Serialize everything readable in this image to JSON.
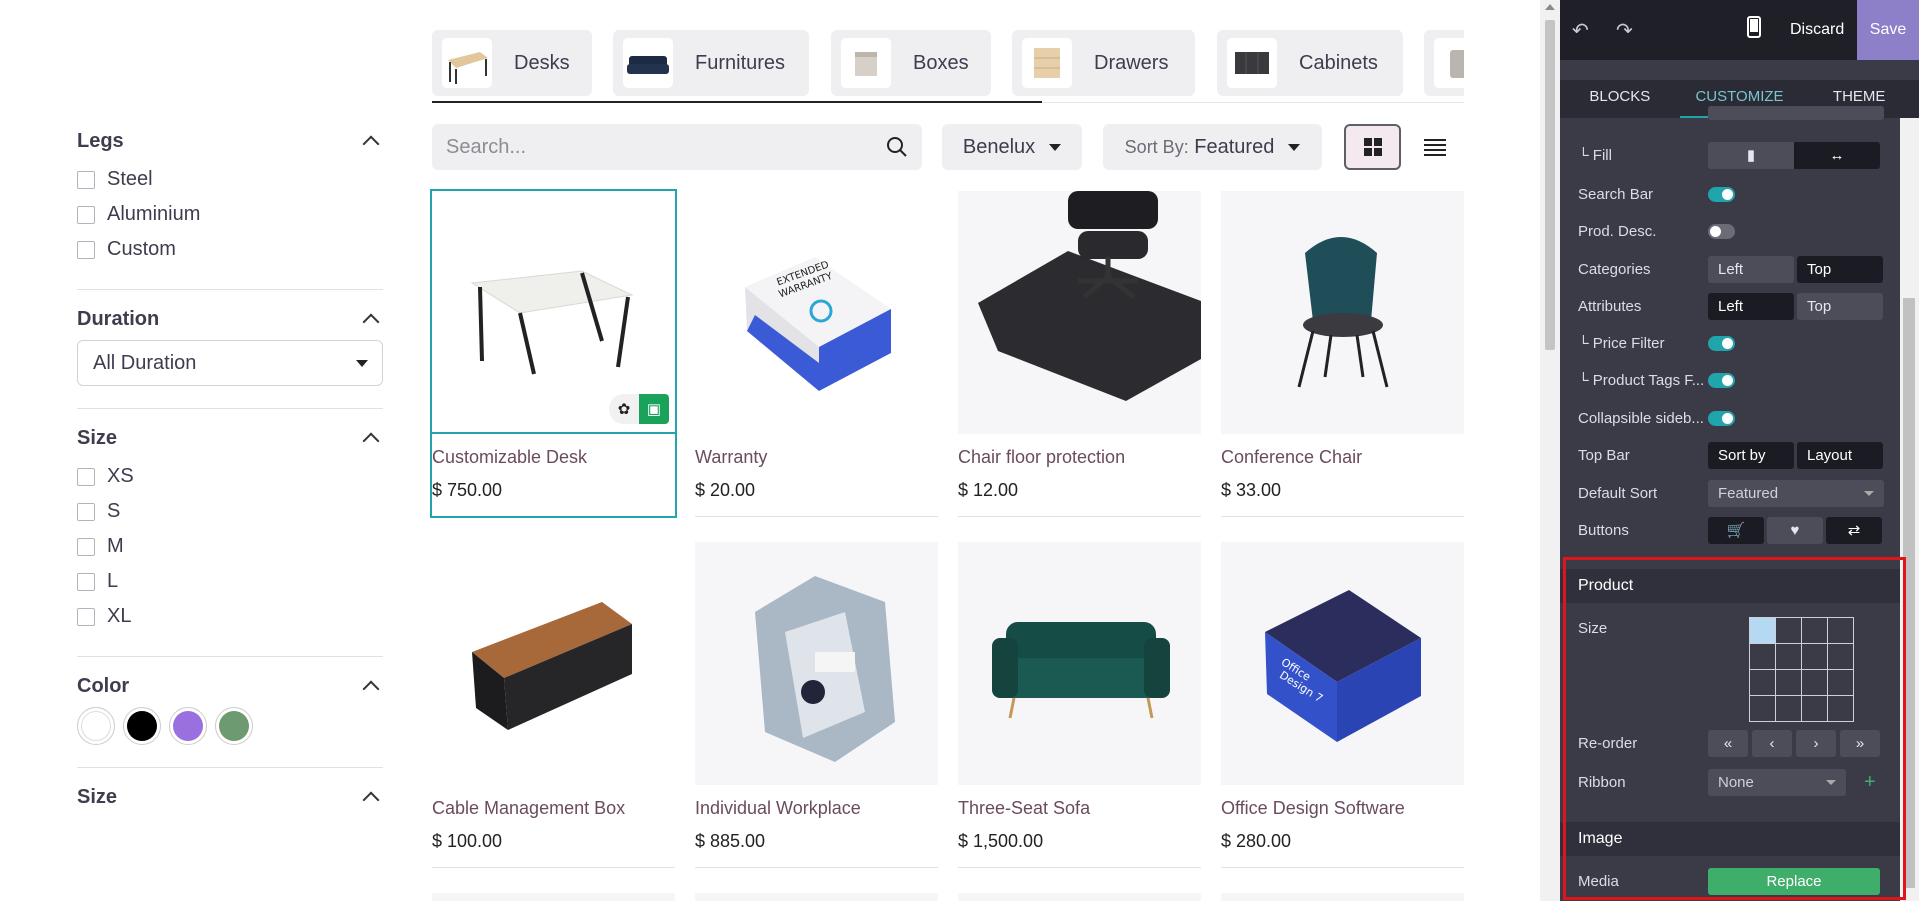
{
  "categories": [
    {
      "label": "Desks",
      "icon": "desk-thumb"
    },
    {
      "label": "Furnitures",
      "icon": "sofa-thumb"
    },
    {
      "label": "Boxes",
      "icon": "box-thumb"
    },
    {
      "label": "Drawers",
      "icon": "drawer-thumb"
    },
    {
      "label": "Cabinets",
      "icon": "cabinet-thumb"
    }
  ],
  "toolbar": {
    "search_placeholder": "Search...",
    "pricelist": "Benelux",
    "sort_prefix": "Sort By:",
    "sort_value": "Featured"
  },
  "filters": {
    "legs": {
      "title": "Legs",
      "options": [
        "Steel",
        "Aluminium",
        "Custom"
      ]
    },
    "duration": {
      "title": "Duration",
      "value": "All Duration"
    },
    "size": {
      "title": "Size",
      "options": [
        "XS",
        "S",
        "M",
        "L",
        "XL"
      ]
    },
    "color": {
      "title": "Color",
      "swatches": [
        "#ffffff",
        "#000000",
        "#9a6fe0",
        "#6e9a72"
      ]
    },
    "size2": {
      "title": "Size"
    }
  },
  "products": [
    {
      "name": "Customizable Desk",
      "price": "$ 750.00"
    },
    {
      "name": "Warranty",
      "price": "$ 20.00"
    },
    {
      "name": "Chair floor protection",
      "price": "$ 12.00"
    },
    {
      "name": "Conference Chair",
      "price": "$ 33.00"
    },
    {
      "name": "Cable Management Box",
      "price": "$ 100.00"
    },
    {
      "name": "Individual Workplace",
      "price": "$ 885.00"
    },
    {
      "name": "Three-Seat Sofa",
      "price": "$ 1,500.00"
    },
    {
      "name": "Office Design Software",
      "price": "$ 280.00"
    }
  ],
  "editor": {
    "discard": "Discard",
    "save": "Save",
    "tabs": [
      "BLOCKS",
      "CUSTOMIZE",
      "THEME"
    ],
    "rows": {
      "fill": "└ Fill",
      "search_bar": "Search Bar",
      "prod_desc": "Prod. Desc.",
      "categories": "Categories",
      "attributes": "Attributes",
      "price_filter": "└ Price Filter",
      "product_tags": "└ Product Tags F...",
      "collapsible": "Collapsible sideb...",
      "top_bar": "Top Bar",
      "default_sort": "Default Sort",
      "buttons": "Buttons"
    },
    "left": "Left",
    "top": "Top",
    "sort_by": "Sort by",
    "layout": "Layout",
    "default_sort_value": "Featured",
    "product_section": "Product",
    "size_label": "Size",
    "reorder_label": "Re-order",
    "ribbon_label": "Ribbon",
    "ribbon_value": "None",
    "image_section": "Image",
    "media_label": "Media",
    "replace": "Replace",
    "reorder_buttons": [
      "«",
      "‹",
      "›",
      "»"
    ]
  }
}
